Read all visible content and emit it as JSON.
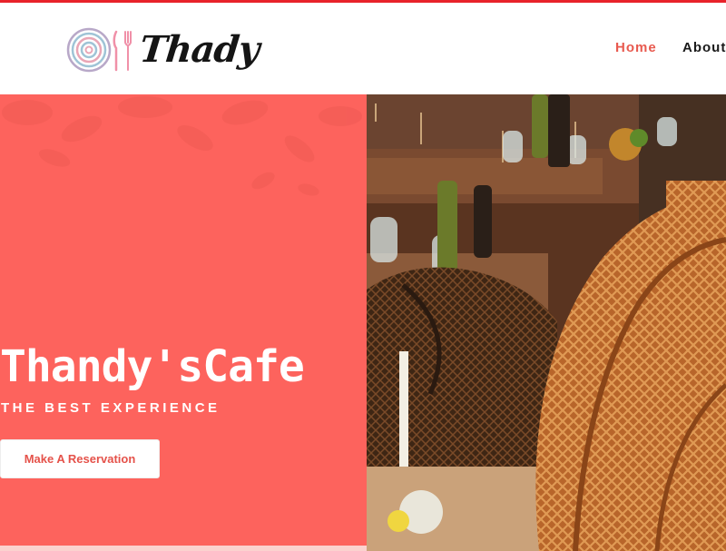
{
  "brand": {
    "name": "Thady",
    "logo_icon": "plate-fork-knife-icon"
  },
  "nav": {
    "items": [
      {
        "label": "Home",
        "active": true
      },
      {
        "label": "About",
        "active": false
      }
    ]
  },
  "hero": {
    "title": "Thandy'sCafe",
    "subtitle": "THE BEST EXPERIENCE",
    "cta_label": "Make A Reservation",
    "background_image": "restaurant-interior-wicker-chairs"
  },
  "colors": {
    "accent": "#fd635d",
    "nav_active": "#e85a4f",
    "top_border": "#e8222a",
    "button_text": "#e5524a"
  }
}
